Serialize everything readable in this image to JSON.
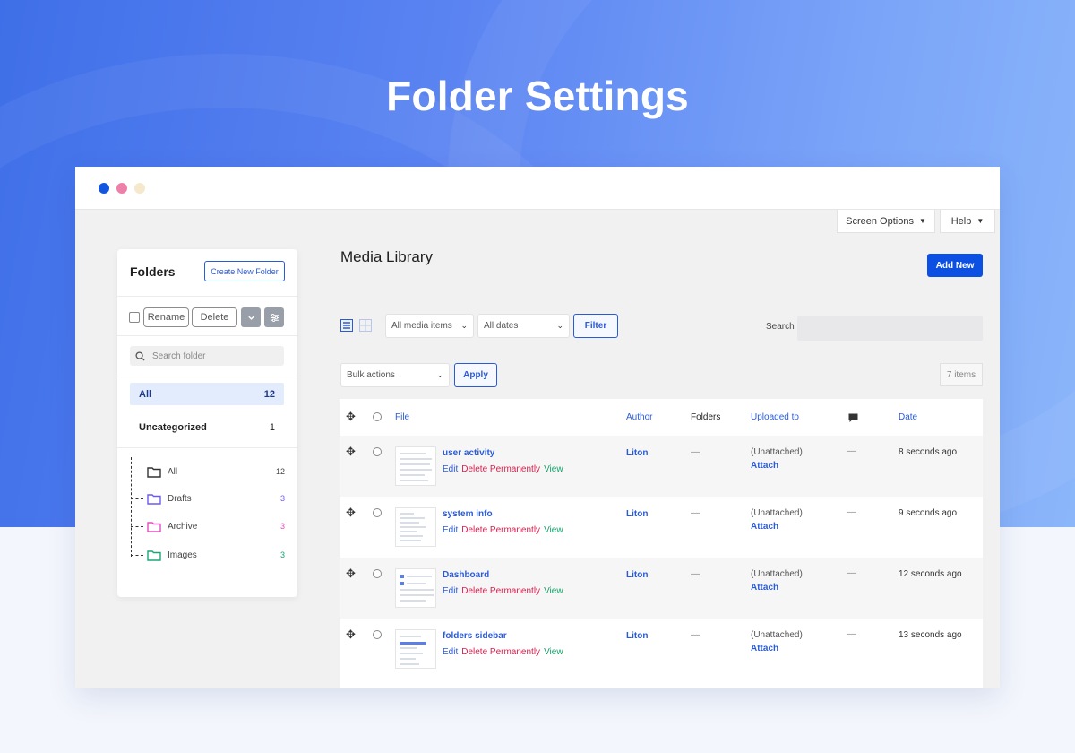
{
  "hero": {
    "title": "Folder Settings"
  },
  "window": {
    "dots": [
      "#1256e0",
      "#ee7fa8",
      "#f5e8cc"
    ]
  },
  "topbar": {
    "screen_options": "Screen Options",
    "help": "Help"
  },
  "sidebar": {
    "title": "Folders",
    "create_button": "Create New Folder",
    "rename_button": "Rename",
    "delete_button": "Delete",
    "search_placeholder": "Search folder",
    "all": {
      "label": "All",
      "count": "12"
    },
    "uncategorized": {
      "label": "Uncategorized",
      "count": "1"
    },
    "tree": [
      {
        "label": "All",
        "count": "12",
        "color": "#333333"
      },
      {
        "label": "Drafts",
        "count": "3",
        "color": "#6b5bf2"
      },
      {
        "label": "Archive",
        "count": "3",
        "color": "#e24fbf"
      },
      {
        "label": "Images",
        "count": "3",
        "color": "#18a775"
      }
    ]
  },
  "main": {
    "title": "Media Library",
    "add_new": "Add New",
    "media_filter": "All media items",
    "date_filter": "All dates",
    "filter_button": "Filter",
    "search_label": "Search",
    "bulk_actions": "Bulk actions",
    "apply_button": "Apply",
    "items_count": "7 items",
    "columns": [
      "File",
      "Author",
      "Folders",
      "Uploaded to",
      "Date"
    ],
    "rows": [
      {
        "file": "user activity",
        "author": "Liton",
        "folders": "—",
        "uploaded": "(Unattached)",
        "attach": "Attach",
        "comments": "—",
        "date": "8 seconds ago"
      },
      {
        "file": "system info",
        "author": "Liton",
        "folders": "—",
        "uploaded": "(Unattached)",
        "attach": "Attach",
        "comments": "—",
        "date": "9 seconds ago"
      },
      {
        "file": "Dashboard",
        "author": "Liton",
        "folders": "—",
        "uploaded": "(Unattached)",
        "attach": "Attach",
        "comments": "—",
        "date": "12 seconds ago"
      },
      {
        "file": "folders sidebar",
        "author": "Liton",
        "folders": "—",
        "uploaded": "(Unattached)",
        "attach": "Attach",
        "comments": "—",
        "date": "13 seconds ago"
      }
    ],
    "row_actions": {
      "edit": "Edit",
      "delete": "Delete Permanently",
      "view": "View"
    }
  }
}
